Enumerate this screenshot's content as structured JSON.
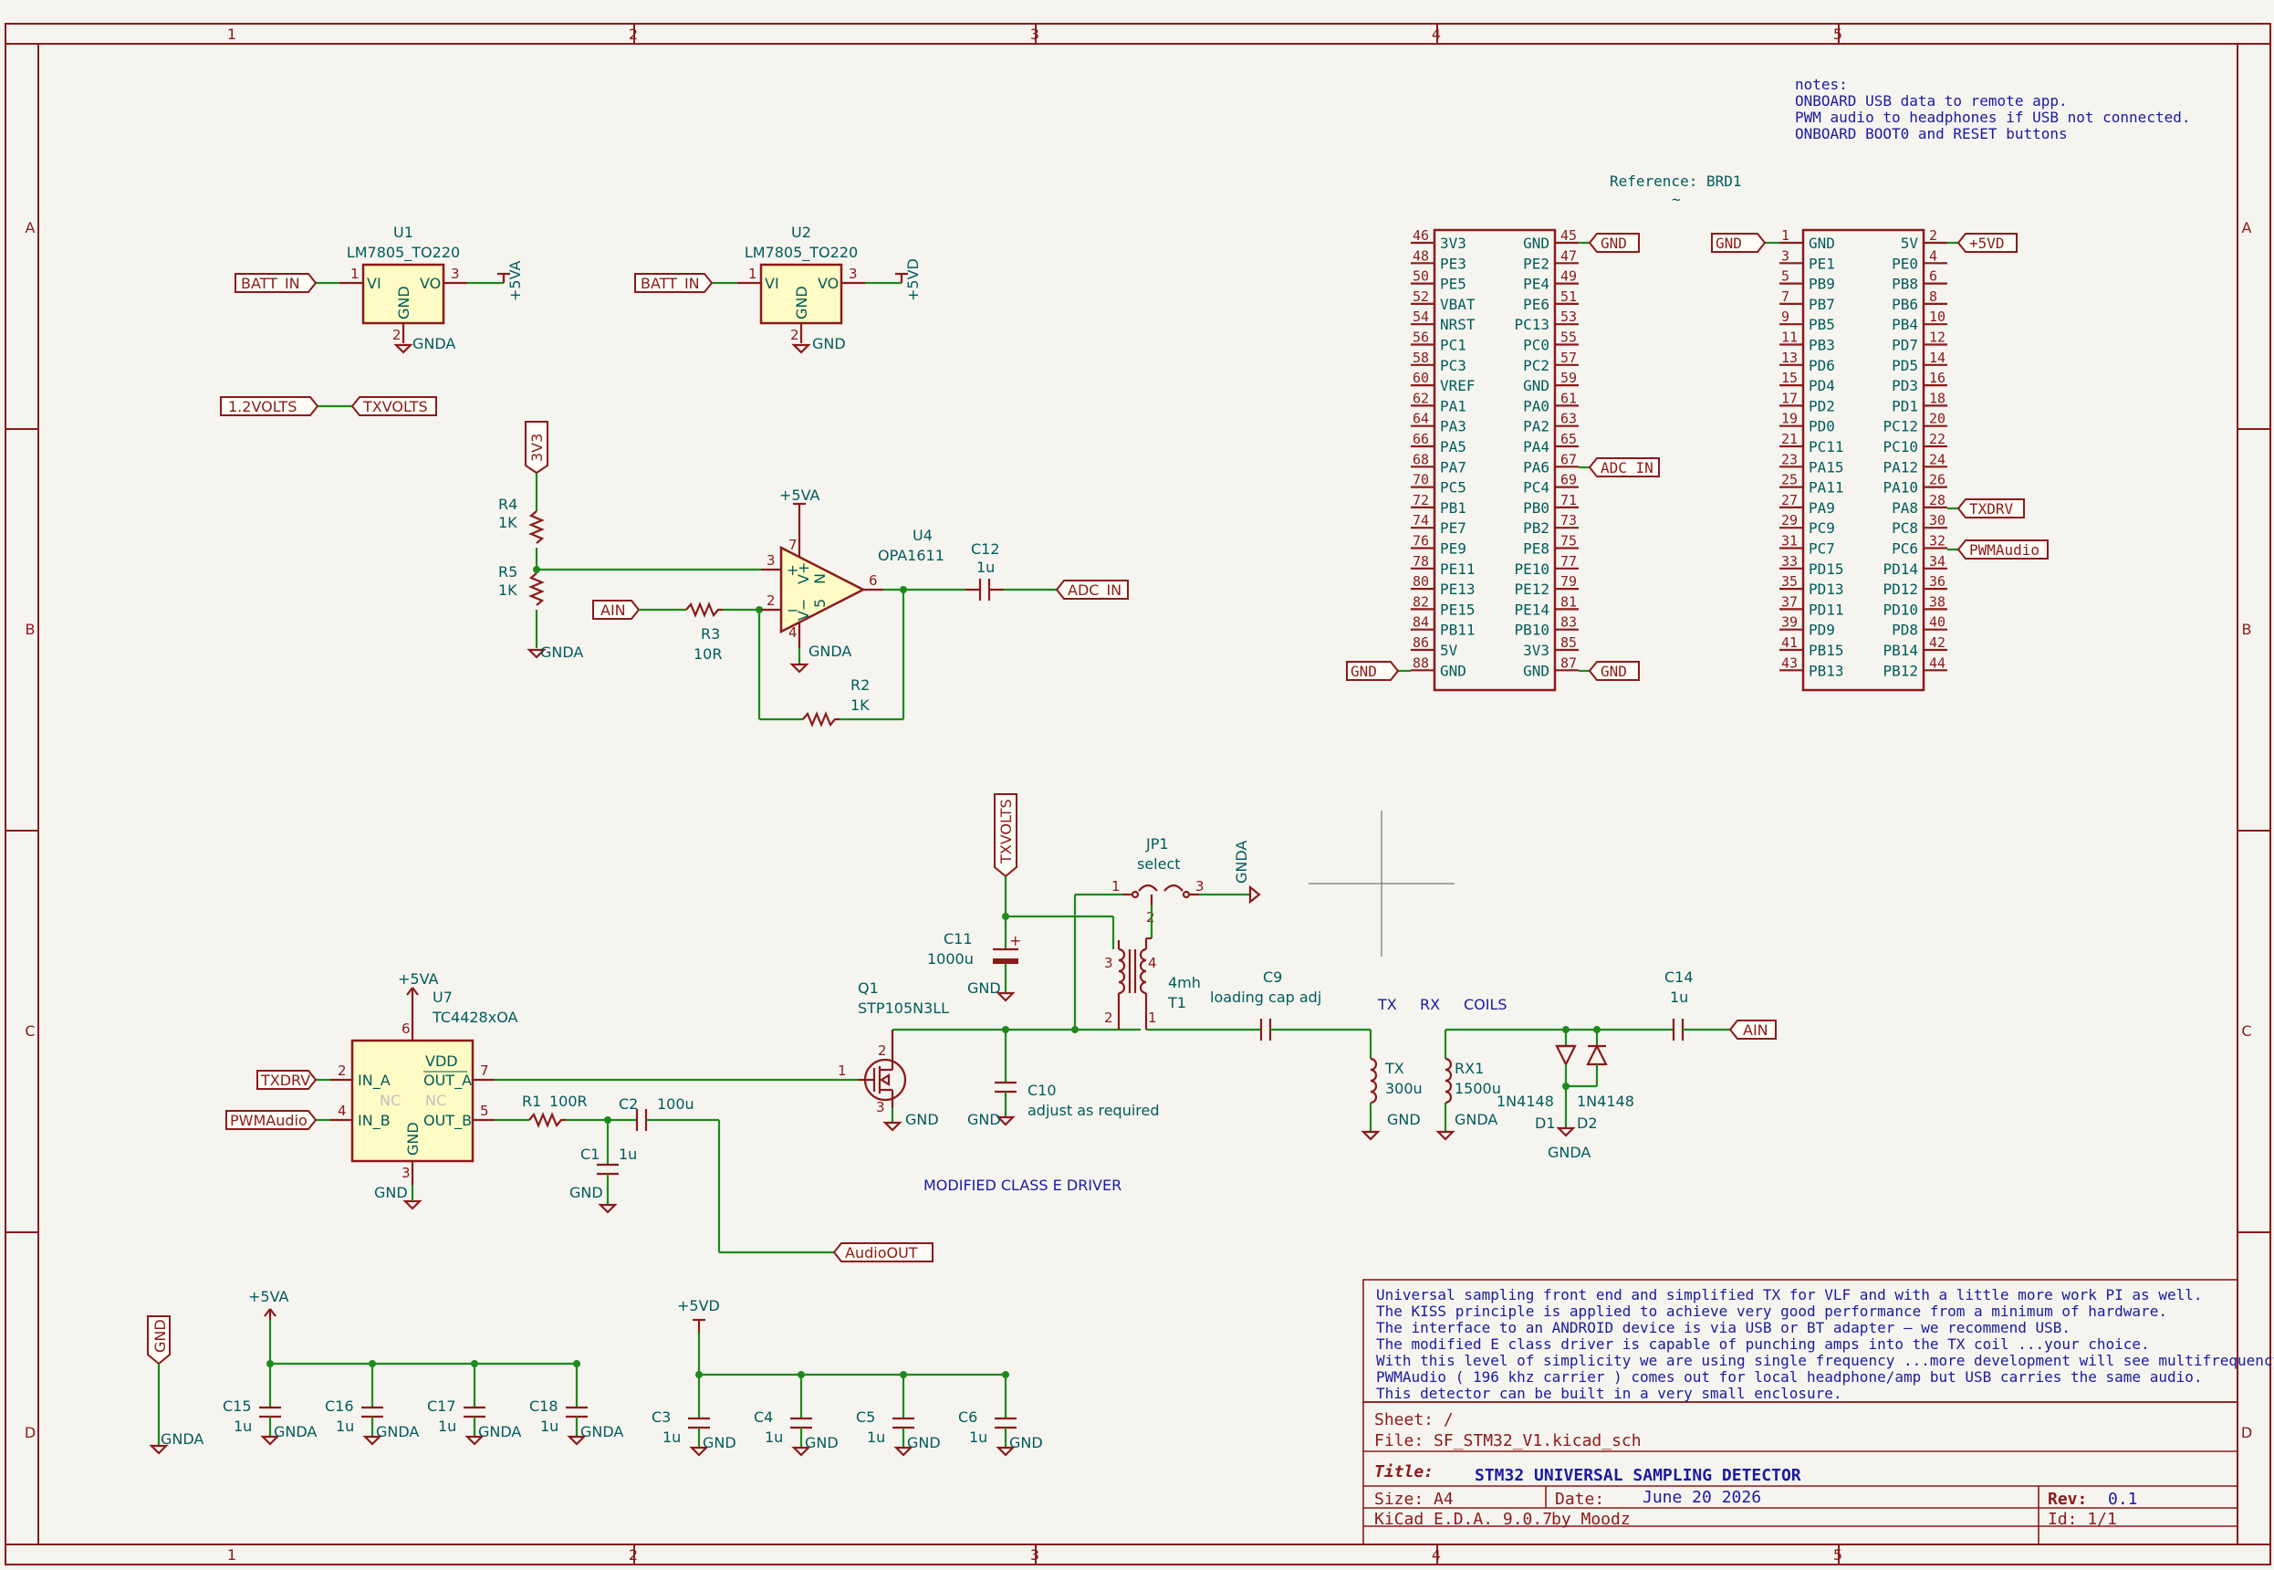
{
  "border": {
    "columns": [
      "1",
      "2",
      "3",
      "4",
      "5"
    ],
    "rows": [
      "A",
      "B",
      "C",
      "D"
    ]
  },
  "notes": [
    "notes:",
    "ONBOARD USB data to remote app.",
    "PWM audio to headphones if USB not connected.",
    "ONBOARD BOOT0 and RESET buttons"
  ],
  "regulators": [
    {
      "ref": "U1",
      "value": "LM7805_TO220",
      "in_label": "BATT_IN",
      "out_power": "+5VA",
      "gnd_power": "GNDA",
      "pin_in": "1",
      "pin_out": "3",
      "pin_gnd": "2",
      "pn_in": "VI",
      "pn_out": "VO",
      "pn_gnd": "GND"
    },
    {
      "ref": "U2",
      "value": "LM7805_TO220",
      "in_label": "BATT_IN",
      "out_power": "+5VD",
      "gnd_power": "GND",
      "pin_in": "1",
      "pin_out": "3",
      "pin_gnd": "2",
      "pn_in": "VI",
      "pn_out": "VO",
      "pn_gnd": "GND"
    }
  ],
  "alias": {
    "left": "1.2VOLTS",
    "right": "TXVOLTS"
  },
  "opamp": {
    "ref": "U4",
    "value": "OPA1611",
    "supply": "+5VA",
    "gnd": "GNDA",
    "pins": {
      "noninv": "3",
      "inv": "2",
      "out": "6",
      "vpos": "7",
      "vneg": "4"
    },
    "pin_names": {
      "plus": "+",
      "minus": "−",
      "vpos": "V+",
      "vneg": "V−",
      "n1": "5",
      "n2": "N"
    },
    "r4": {
      "ref": "R4",
      "value": "1K"
    },
    "r5": {
      "ref": "R5",
      "value": "1K"
    },
    "r3": {
      "ref": "R3",
      "value": "10R"
    },
    "r2": {
      "ref": "R2",
      "value": "1K"
    },
    "c12": {
      "ref": "C12",
      "value": "1u"
    },
    "rail": "3V3",
    "gnd_bottom": "GNDA",
    "ain": "AIN",
    "adc": "ADC_IN"
  },
  "board": {
    "reference": "Reference: BRD1",
    "tilde": "~",
    "left_header": {
      "rows": [
        {
          "pl": "46",
          "nl": "3V3",
          "nr": "GND",
          "pr": "45"
        },
        {
          "pl": "48",
          "nl": "PE3",
          "nr": "PE2",
          "pr": "47"
        },
        {
          "pl": "50",
          "nl": "PE5",
          "nr": "PE4",
          "pr": "49"
        },
        {
          "pl": "52",
          "nl": "VBAT",
          "nr": "PE6",
          "pr": "51"
        },
        {
          "pl": "54",
          "nl": "NRST",
          "nr": "PC13",
          "pr": "53"
        },
        {
          "pl": "56",
          "nl": "PC1",
          "nr": "PC0",
          "pr": "55"
        },
        {
          "pl": "58",
          "nl": "PC3",
          "nr": "PC2",
          "pr": "57"
        },
        {
          "pl": "60",
          "nl": "VREF",
          "nr": "GND",
          "pr": "59"
        },
        {
          "pl": "62",
          "nl": "PA1",
          "nr": "PA0",
          "pr": "61"
        },
        {
          "pl": "64",
          "nl": "PA3",
          "nr": "PA2",
          "pr": "63"
        },
        {
          "pl": "66",
          "nl": "PA5",
          "nr": "PA4",
          "pr": "65"
        },
        {
          "pl": "68",
          "nl": "PA7",
          "nr": "PA6",
          "pr": "67"
        },
        {
          "pl": "70",
          "nl": "PC5",
          "nr": "PC4",
          "pr": "69"
        },
        {
          "pl": "72",
          "nl": "PB1",
          "nr": "PB0",
          "pr": "71"
        },
        {
          "pl": "74",
          "nl": "PE7",
          "nr": "PB2",
          "pr": "73"
        },
        {
          "pl": "76",
          "nl": "PE9",
          "nr": "PE8",
          "pr": "75"
        },
        {
          "pl": "78",
          "nl": "PE11",
          "nr": "PE10",
          "pr": "77"
        },
        {
          "pl": "80",
          "nl": "PE13",
          "nr": "PE12",
          "pr": "79"
        },
        {
          "pl": "82",
          "nl": "PE15",
          "nr": "PE14",
          "pr": "81"
        },
        {
          "pl": "84",
          "nl": "PB11",
          "nr": "PB10",
          "pr": "83"
        },
        {
          "pl": "86",
          "nl": "5V",
          "nr": "3V3",
          "pr": "85"
        },
        {
          "pl": "88",
          "nl": "GND",
          "nr": "GND",
          "pr": "87"
        }
      ],
      "labels": {
        "pin45": "GND",
        "pin67": "ADC_IN",
        "pin88": "GND",
        "pin87": "GND"
      }
    },
    "right_header": {
      "rows": [
        {
          "pl": "1",
          "nl": "GND",
          "nr": "5V",
          "pr": "2"
        },
        {
          "pl": "3",
          "nl": "PE1",
          "nr": "PE0",
          "pr": "4"
        },
        {
          "pl": "5",
          "nl": "PB9",
          "nr": "PB8",
          "pr": "6"
        },
        {
          "pl": "7",
          "nl": "PB7",
          "nr": "PB6",
          "pr": "8"
        },
        {
          "pl": "9",
          "nl": "PB5",
          "nr": "PB4",
          "pr": "10"
        },
        {
          "pl": "11",
          "nl": "PB3",
          "nr": "PD7",
          "pr": "12"
        },
        {
          "pl": "13",
          "nl": "PD6",
          "nr": "PD5",
          "pr": "14"
        },
        {
          "pl": "15",
          "nl": "PD4",
          "nr": "PD3",
          "pr": "16"
        },
        {
          "pl": "17",
          "nl": "PD2",
          "nr": "PD1",
          "pr": "18"
        },
        {
          "pl": "19",
          "nl": "PD0",
          "nr": "PC12",
          "pr": "20"
        },
        {
          "pl": "21",
          "nl": "PC11",
          "nr": "PC10",
          "pr": "22"
        },
        {
          "pl": "23",
          "nl": "PA15",
          "nr": "PA12",
          "pr": "24"
        },
        {
          "pl": "25",
          "nl": "PA11",
          "nr": "PA10",
          "pr": "26"
        },
        {
          "pl": "27",
          "nl": "PA9",
          "nr": "PA8",
          "pr": "28"
        },
        {
          "pl": "29",
          "nl": "PC9",
          "nr": "PC8",
          "pr": "30"
        },
        {
          "pl": "31",
          "nl": "PC7",
          "nr": "PC6",
          "pr": "32"
        },
        {
          "pl": "33",
          "nl": "PD15",
          "nr": "PD14",
          "pr": "34"
        },
        {
          "pl": "35",
          "nl": "PD13",
          "nr": "PD12",
          "pr": "36"
        },
        {
          "pl": "37",
          "nl": "PD11",
          "nr": "PD10",
          "pr": "38"
        },
        {
          "pl": "39",
          "nl": "PD9",
          "nr": "PD8",
          "pr": "40"
        },
        {
          "pl": "41",
          "nl": "PB15",
          "nr": "PB14",
          "pr": "42"
        },
        {
          "pl": "43",
          "nl": "PB13",
          "nr": "PB12",
          "pr": "44"
        }
      ],
      "labels": {
        "pin1": "GND",
        "pin2": "+5VD",
        "pin28": "TXDRV",
        "pin32": "PWMAudio"
      }
    }
  },
  "driver": {
    "u7": {
      "ref": "U7",
      "value": "TC4428xOA",
      "supply": "+5VA",
      "gnd": "GND",
      "pin_ina": "2",
      "pin_inb": "4",
      "pin_outa": "7",
      "pin_outb": "5",
      "pin_vdd": "6",
      "pin_gnd": "3",
      "pn_ina": "IN_A",
      "pn_inb": "IN_B",
      "pn_outa": "OUT_A",
      "pn_outb": "OUT_B",
      "pn_vdd": "VDD",
      "pn_gnd": "GND",
      "pn_nc1": "NC",
      "pn_nc2": "NC",
      "in_a_label": "TXDRV",
      "in_b_label": "PWMAudio"
    },
    "r1": {
      "ref": "R1",
      "value": "100R"
    },
    "c2": {
      "ref": "C2",
      "value": "100u"
    },
    "c1": {
      "ref": "C1",
      "value": "1u",
      "gnd": "GND"
    },
    "audio_out": "AudioOUT",
    "q1": {
      "ref": "Q1",
      "value": "STP105N3LL",
      "gnd": "GND",
      "pin_g": "1",
      "pin_d": "2",
      "pin_s": "3"
    },
    "txvolts": "TXVOLTS",
    "c11": {
      "ref": "C11",
      "value": "1000u",
      "gnd": "GND"
    },
    "c10": {
      "ref": "C10",
      "value": "adjust as required",
      "gnd": "GND"
    },
    "jp1": {
      "ref": "JP1",
      "value": "select",
      "gnd": "GNDA",
      "p1": "1",
      "p2": "2",
      "p3": "3"
    },
    "t1": {
      "ref": "T1",
      "value": "4mh",
      "p1": "1",
      "p2": "2",
      "p3": "3",
      "p4": "4"
    },
    "c9": {
      "ref": "C9",
      "value": "loading cap adj"
    },
    "coil_labels": [
      "TX",
      "RX",
      "COILS"
    ],
    "tx": {
      "ref": "TX",
      "value": "300u",
      "gnd": "GND"
    },
    "rx": {
      "ref": "RX1",
      "value": "1500u",
      "gnd": "GNDA"
    },
    "d1": {
      "ref": "D1",
      "value": "1N4148"
    },
    "d2": {
      "ref": "D2",
      "value": "1N4148"
    },
    "diode_gnd": "GNDA",
    "c14": {
      "ref": "C14",
      "value": "1u"
    },
    "ain": "AIN",
    "title": "MODIFIED CLASS E DRIVER"
  },
  "decoupling": {
    "gnd_flag": "GND",
    "gnd_flag_bottom": "GNDA",
    "analog": {
      "power": "+5VA",
      "caps": [
        {
          "ref": "C15",
          "value": "1u",
          "gnd": "GNDA"
        },
        {
          "ref": "C16",
          "value": "1u",
          "gnd": "GNDA"
        },
        {
          "ref": "C17",
          "value": "1u",
          "gnd": "GNDA"
        },
        {
          "ref": "C18",
          "value": "1u",
          "gnd": "GNDA"
        }
      ]
    },
    "digital": {
      "power": "+5VD",
      "caps": [
        {
          "ref": "C3",
          "value": "1u",
          "gnd": "GND"
        },
        {
          "ref": "C4",
          "value": "1u",
          "gnd": "GND"
        },
        {
          "ref": "C5",
          "value": "1u",
          "gnd": "GND"
        },
        {
          "ref": "C6",
          "value": "1u",
          "gnd": "GND"
        }
      ]
    }
  },
  "description": [
    "Universal sampling front end and simplified TX for VLF and with a little more work PI as well.",
    "The KISS principle is applied to achieve very good performance from a minimum of hardware.",
    "The interface to an ANDROID device is via USB or BT adapter — we recommend USB.",
    "The modified E class driver is capable of punching amps into the TX coil ...your choice.",
    "With this level of simplicity we are using single frequency ...more development will see multifrequency.",
    "PWMAudio ( 196 khz carrier ) comes out for local headphone/amp but USB carries the same audio.",
    "This detector can be built in a very small enclosure."
  ],
  "title_block": {
    "sheet_label": "Sheet: /",
    "file_label": "File: SF_STM32_V1.kicad_sch",
    "title_label": "Title:",
    "title": "STM32 UNIVERSAL SAMPLING DETECTOR",
    "size": "Size: A4",
    "date_label": "Date:",
    "date": "June 20 2026",
    "rev_label": "Rev:",
    "rev": "0.1",
    "kicad": "KiCad E.D.A. 9.0.7",
    "author": "by Moodz",
    "id": "Id: 1/1"
  },
  "colors": {
    "frame": "#8b1a1a",
    "wire": "#1c8a1c",
    "body_fill": "#fffbc4",
    "value_text": "#005b5b",
    "note_text": "#1a1aa0",
    "background": "#f5f4ef"
  }
}
